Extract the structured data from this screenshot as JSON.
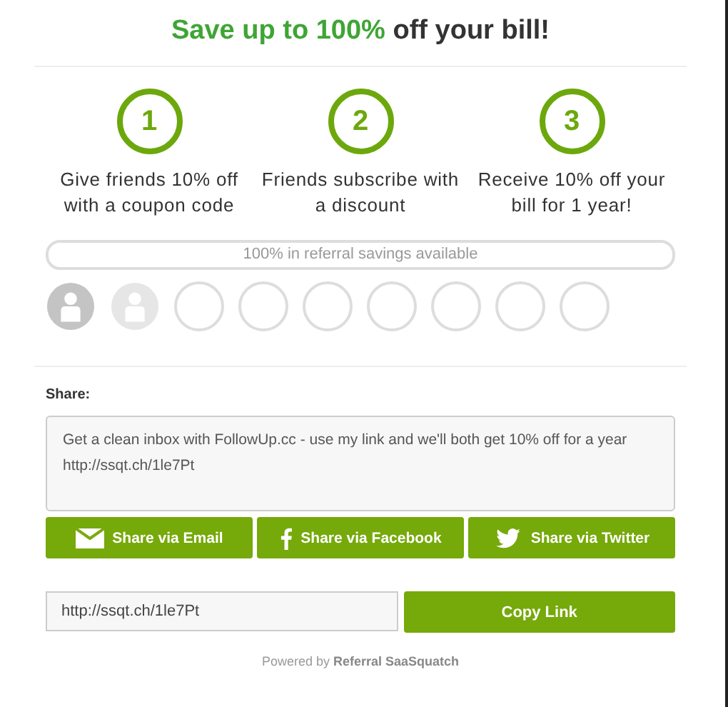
{
  "headline": {
    "highlight": "Save up to 100%",
    "rest": "off your bill!"
  },
  "steps": [
    {
      "number": "1",
      "text": "Give friends 10% off with a coupon code"
    },
    {
      "number": "2",
      "text": "Friends subscribe with a discount"
    },
    {
      "number": "3",
      "text": "Receive 10% off your bill for 1 year!"
    }
  ],
  "savings_bar": {
    "label": "100% in referral savings available"
  },
  "referral_slots": [
    {
      "kind": "joined"
    },
    {
      "kind": "pending"
    },
    {
      "kind": "empty"
    },
    {
      "kind": "empty"
    },
    {
      "kind": "empty"
    },
    {
      "kind": "empty"
    },
    {
      "kind": "empty"
    },
    {
      "kind": "empty"
    },
    {
      "kind": "empty"
    }
  ],
  "share": {
    "label": "Share:",
    "message": "Get a clean inbox with FollowUp.cc - use my link and we'll both get 10% off for a year http://ssqt.ch/1le7Pt",
    "buttons": [
      {
        "kind": "email",
        "label": "Share via Email"
      },
      {
        "kind": "facebook",
        "label": "Share via Facebook"
      },
      {
        "kind": "twitter",
        "label": "Share via Twitter"
      }
    ]
  },
  "link": {
    "value": "http://ssqt.ch/1le7Pt",
    "button": "Copy Link"
  },
  "footer": {
    "prefix": "Powered by",
    "brand": "Referral SaaSquatch"
  }
}
